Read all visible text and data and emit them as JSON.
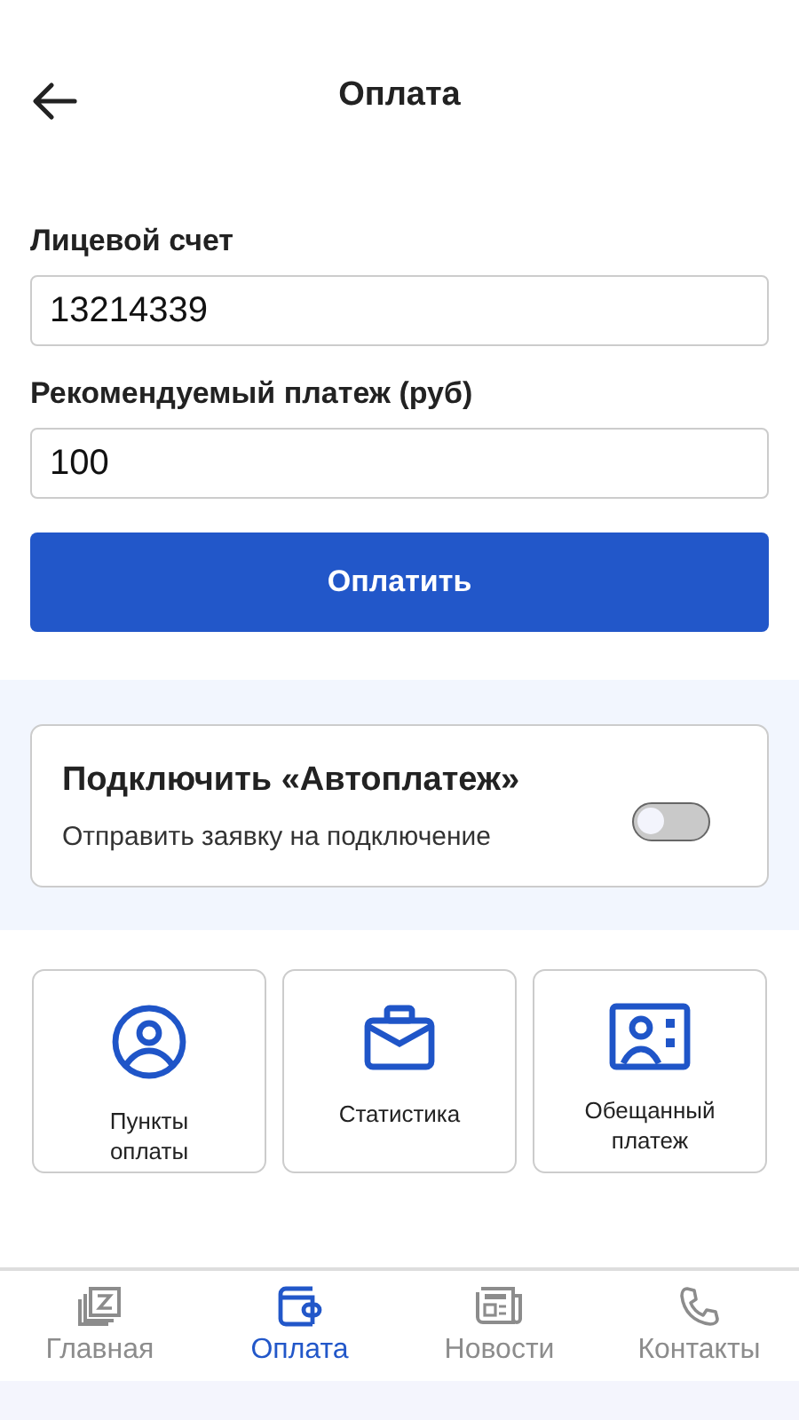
{
  "header": {
    "title": "Оплата"
  },
  "form": {
    "fields": [
      {
        "label": "Лицевой счет",
        "value": "13214339"
      },
      {
        "label": "Рекомендуемый платеж (руб)",
        "value": "100"
      }
    ],
    "submit": "Оплатить"
  },
  "autopay": {
    "title": "Подключить «Автоплатеж»",
    "subtitle": "Отправить заявку на подключение",
    "on": false
  },
  "tiles": [
    {
      "label": "Пункты\nоплаты"
    },
    {
      "label": "Статистика"
    },
    {
      "label": "Обещанный\nплатеж"
    }
  ],
  "nav": [
    {
      "label": "Главная",
      "selected": false
    },
    {
      "label": "Оплата",
      "selected": true
    },
    {
      "label": "Новости",
      "selected": false
    },
    {
      "label": "Контакты",
      "selected": false
    }
  ]
}
